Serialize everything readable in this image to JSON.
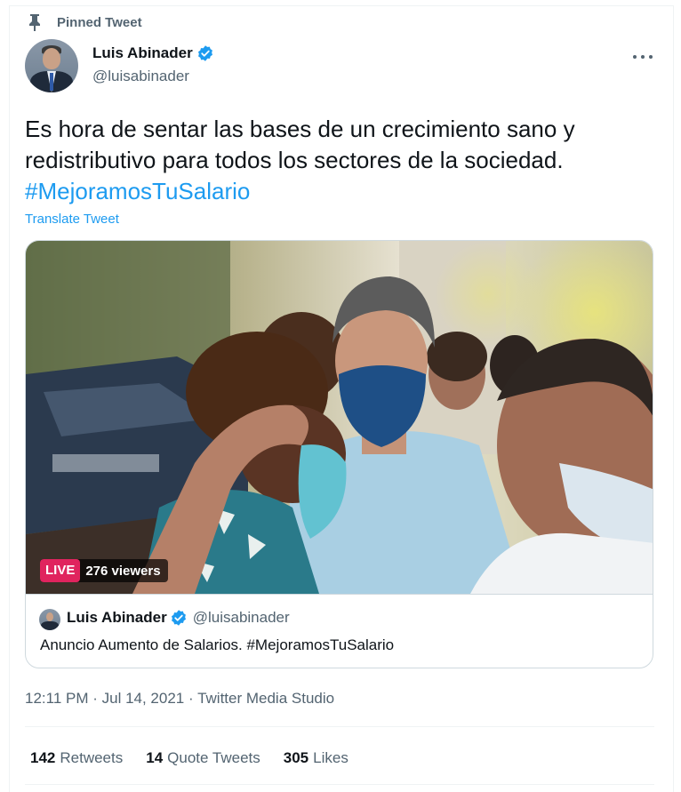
{
  "pinned": {
    "label": "Pinned Tweet",
    "icon": "pin-icon"
  },
  "author": {
    "display_name": "Luis Abinader",
    "handle": "@luisabinader",
    "verified": true,
    "avatar": "profile-photo"
  },
  "tweet": {
    "line1": "Es hora de sentar las bases de un crecimiento sano y",
    "line2": "redistributivo para todos los sectores de la sociedad.",
    "hashtag": "#MejoramosTuSalario"
  },
  "translate_label": "Translate Tweet",
  "media": {
    "live_label": "LIVE",
    "viewers": "276 viewers",
    "card_name": "Luis Abinader",
    "card_handle": "@luisabinader",
    "card_description": "Anuncio Aumento de Salarios. #MejoramosTuSalario"
  },
  "meta": {
    "time": "12:11 PM",
    "date": "Jul 14, 2021",
    "source": "Twitter Media Studio",
    "separator": " · "
  },
  "stats": {
    "retweets_count": "142",
    "retweets_label": "Retweets",
    "quotes_count": "14",
    "quotes_label": "Quote Tweets",
    "likes_count": "305",
    "likes_label": "Likes"
  },
  "colors": {
    "accent": "#1d9bf0",
    "live": "#e0245e",
    "secondary_text": "#536471",
    "primary_text": "#0f1419"
  }
}
